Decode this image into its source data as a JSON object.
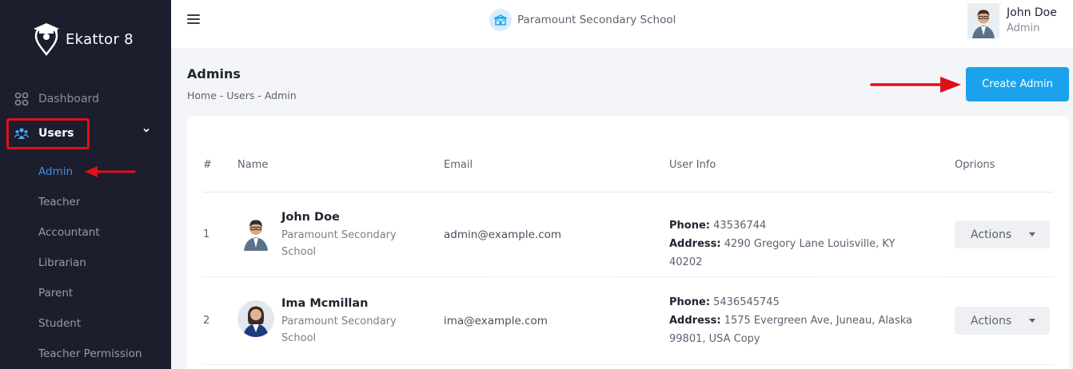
{
  "app": {
    "name": "Ekattor 8",
    "logo_icon": "map-pin-graduation-cap-icon"
  },
  "sidebar": {
    "dashboard_label": "Dashboard",
    "users_label": "Users",
    "sub_items": [
      "Admin",
      "Teacher",
      "Accountant",
      "Librarian",
      "Parent",
      "Student",
      "Teacher Permission"
    ],
    "active_sub_item": "Admin"
  },
  "topbar": {
    "school_name": "Paramount Secondary School",
    "user_name": "John Doe",
    "user_role": "Admin"
  },
  "page": {
    "title": "Admins",
    "breadcrumb": "Home - Users - Admin",
    "create_button": "Create Admin"
  },
  "table": {
    "headers": [
      "#",
      "Name",
      "Email",
      "User Info",
      "Oprions"
    ],
    "rows": [
      {
        "num": "1",
        "name": "John Doe",
        "school": "Paramount Secondary School",
        "email": "admin@example.com",
        "phone_label": "Phone:",
        "phone": "43536744",
        "address_label": "Address:",
        "address": "4290 Gregory Lane Louisville, KY 40202",
        "action": "Actions"
      },
      {
        "num": "2",
        "name": "Ima Mcmillan",
        "school": "Paramount Secondary School",
        "email": "ima@example.com",
        "phone_label": "Phone:",
        "phone": "5436545745",
        "address_label": "Address:",
        "address": "1575 Evergreen Ave, Juneau, Alaska 99801, USA Copy",
        "action": "Actions"
      }
    ]
  },
  "colors": {
    "sidebar_bg": "#1c1e2e",
    "accent": "#1aa3ec",
    "active_link": "#3d8fe0",
    "annotation_red": "#e0101a"
  }
}
